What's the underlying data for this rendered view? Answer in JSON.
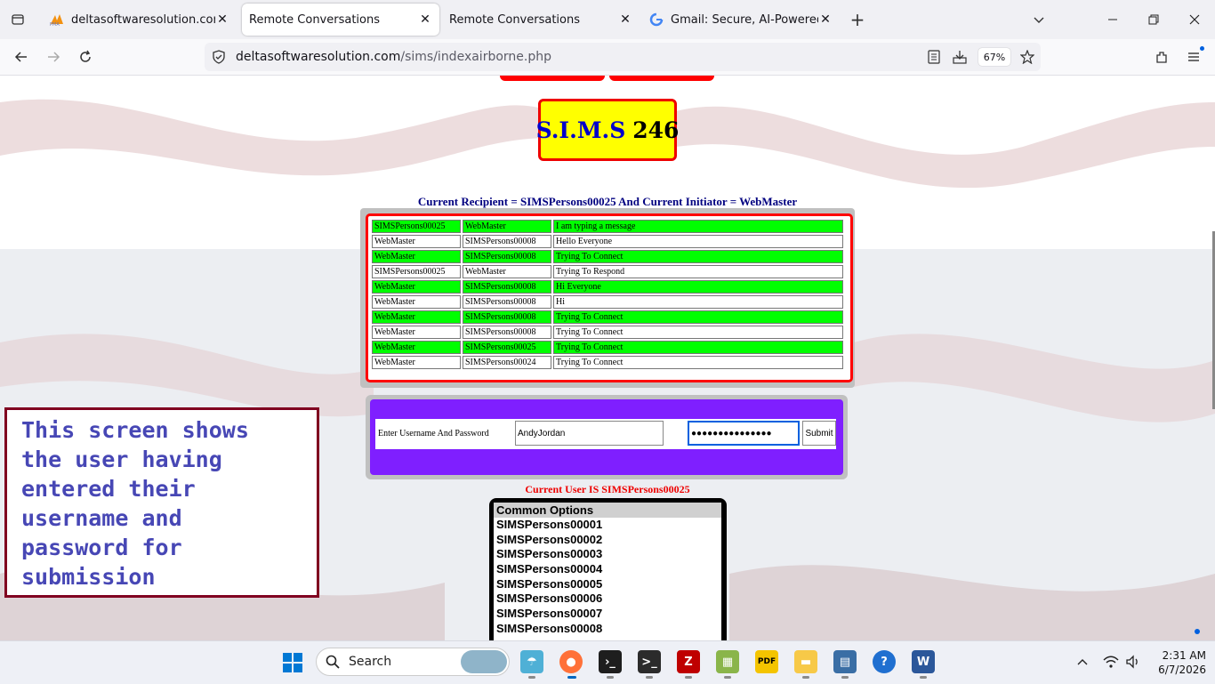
{
  "browser": {
    "tabs": [
      {
        "title": "deltasoftwaresolution.com / localhost / ...",
        "favicon": "phpmyadmin-icon",
        "active": false
      },
      {
        "title": "Remote Conversations",
        "favicon": "",
        "active": true
      },
      {
        "title": "Remote Conversations",
        "favicon": "",
        "active": false
      },
      {
        "title": "Gmail: Secure, AI-Powered Email",
        "favicon": "google-icon",
        "active": false
      }
    ],
    "url_domain": "deltasoftwaresolution.com",
    "url_path": "/sims/indexairborne.php",
    "zoom": "67%"
  },
  "page": {
    "logo_part1": "S.I.M.S",
    "logo_part2": "246",
    "recipient_line": "Current Recipient = SIMSPersons00025 And Current Initiator = WebMaster",
    "messages": [
      {
        "from": "SIMSPersons00025",
        "to": "WebMaster",
        "text": "I am typing a message",
        "style": "g"
      },
      {
        "from": "WebMaster",
        "to": "SIMSPersons00008",
        "text": "Hello Everyone",
        "style": "w"
      },
      {
        "from": "WebMaster",
        "to": "SIMSPersons00008",
        "text": "Trying To Connect",
        "style": "g"
      },
      {
        "from": "SIMSPersons00025",
        "to": "WebMaster",
        "text": "Trying To Respond",
        "style": "w"
      },
      {
        "from": "WebMaster",
        "to": "SIMSPersons00008",
        "text": "Hi Everyone",
        "style": "g"
      },
      {
        "from": "WebMaster",
        "to": "SIMSPersons00008",
        "text": "Hi",
        "style": "w"
      },
      {
        "from": "WebMaster",
        "to": "SIMSPersons00008",
        "text": "Trying To Connect",
        "style": "g"
      },
      {
        "from": "WebMaster",
        "to": "SIMSPersons00008",
        "text": "Trying To Connect",
        "style": "w"
      },
      {
        "from": "WebMaster",
        "to": "SIMSPersons00025",
        "text": "Trying To Connect",
        "style": "g"
      },
      {
        "from": "WebMaster",
        "to": "SIMSPersons00024",
        "text": "Trying To Connect",
        "style": "w"
      }
    ],
    "login": {
      "label": "Enter Username And Password",
      "username": "AndyJordan",
      "password": "●●●●●●●●●●●●●●●",
      "submit": "Submit"
    },
    "current_user": "Current User IS SIMSPersons00025",
    "options_title": "Common Options",
    "options": [
      "SIMSPersons00001",
      "SIMSPersons00002",
      "SIMSPersons00003",
      "SIMSPersons00004",
      "SIMSPersons00005",
      "SIMSPersons00006",
      "SIMSPersons00007",
      "SIMSPersons00008"
    ],
    "note": "This screen shows the user having entered their username and password for submission"
  },
  "taskbar": {
    "search_placeholder": "Search",
    "time": "2:31 AM",
    "date": "6/7/2026"
  },
  "colors": {
    "logo_bg": "#ffff00",
    "logo_border": "#ee0000",
    "row_green": "#00ff00",
    "login_bg": "#7f1fff",
    "note_text": "#4747b5",
    "note_border": "#800020"
  }
}
